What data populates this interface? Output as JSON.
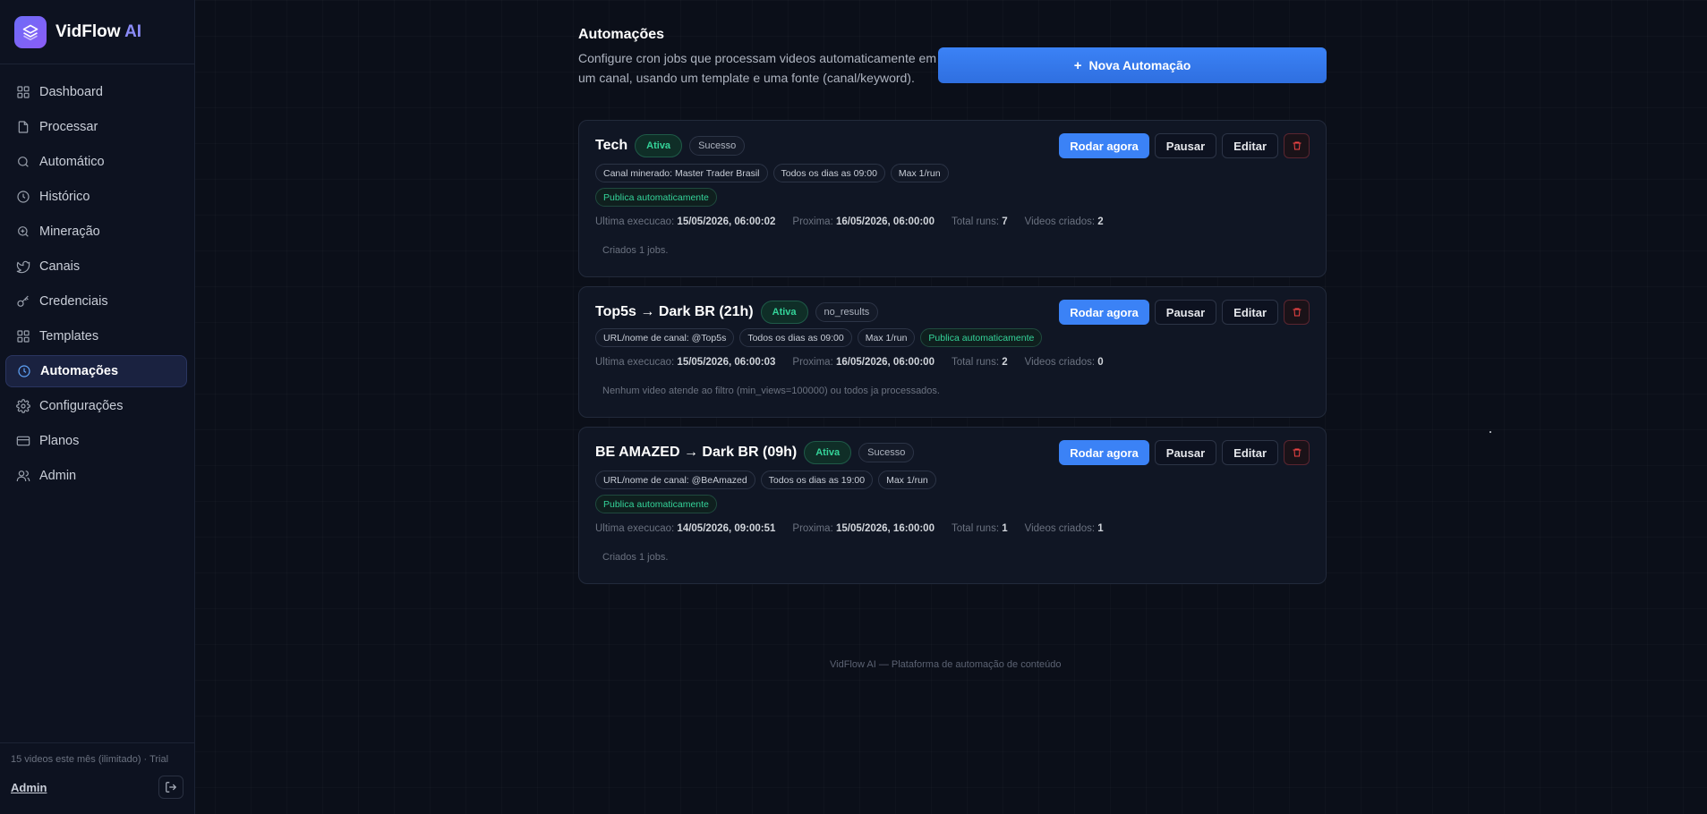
{
  "brand": {
    "name": "VidFlow",
    "accent": "AI"
  },
  "nav": [
    {
      "label": "Dashboard",
      "icon": "grid-icon"
    },
    {
      "label": "Processar",
      "icon": "file-icon"
    },
    {
      "label": "Automático",
      "icon": "search-icon"
    },
    {
      "label": "Histórico",
      "icon": "clock-icon"
    },
    {
      "label": "Mineração",
      "icon": "zoom-icon"
    },
    {
      "label": "Canais",
      "icon": "bird-icon"
    },
    {
      "label": "Credenciais",
      "icon": "key-icon"
    },
    {
      "label": "Templates",
      "icon": "grid-icon"
    },
    {
      "label": "Automações",
      "icon": "clock-icon",
      "active": true
    },
    {
      "label": "Configurações",
      "icon": "gear-icon"
    },
    {
      "label": "Planos",
      "icon": "card-icon"
    },
    {
      "label": "Admin",
      "icon": "users-icon"
    }
  ],
  "sidebar_footer": {
    "usage": "15 videos este mês (ilimitado) · Trial",
    "user": "Admin"
  },
  "header": {
    "title": "Automações",
    "description": "Configure cron jobs que processam videos automaticamente em um canal, usando um template e uma fonte (canal/keyword).",
    "new_button": "Nova Automação"
  },
  "actions": {
    "run": "Rodar agora",
    "pause": "Pausar",
    "edit": "Editar"
  },
  "stat_labels": {
    "last": "Ultima execucao:",
    "next": "Proxima:",
    "runs": "Total runs:",
    "videos": "Videos criados:"
  },
  "automations": [
    {
      "name": "Tech",
      "state": "Ativa",
      "result": "Sucesso",
      "chips": [
        "Canal minerado: Master Trader Brasil",
        "Todos os dias as 09:00",
        "Max 1/run"
      ],
      "publish": "Publica automaticamente",
      "last_run": "15/05/2026, 06:00:02",
      "next_run": "16/05/2026, 06:00:00",
      "total_runs": "7",
      "videos_created": "2",
      "note": "Criados 1 jobs."
    },
    {
      "name": "Top5s → Dark BR (21h)",
      "state": "Ativa",
      "result": "no_results",
      "chips": [
        "URL/nome de canal: @Top5s",
        "Todos os dias as 09:00",
        "Max 1/run"
      ],
      "publish": "Publica automaticamente",
      "last_run": "15/05/2026, 06:00:03",
      "next_run": "16/05/2026, 06:00:00",
      "total_runs": "2",
      "videos_created": "0",
      "note": "Nenhum video atende ao filtro (min_views=100000) ou todos ja processados."
    },
    {
      "name": "BE AMAZED → Dark BR (09h)",
      "state": "Ativa",
      "result": "Sucesso",
      "chips": [
        "URL/nome de canal: @BeAmazed",
        "Todos os dias as 19:00",
        "Max 1/run"
      ],
      "publish": "Publica automaticamente",
      "last_run": "14/05/2026, 09:00:51",
      "next_run": "15/05/2026, 16:00:00",
      "total_runs": "1",
      "videos_created": "1",
      "note": "Criados 1 jobs."
    }
  ],
  "footer": "VidFlow AI — Plataforma de automação de conteúdo",
  "colors": {
    "background": "#0b0f19",
    "primary": "#3b82f6",
    "success": "#34d399",
    "danger": "#ef4444",
    "brand": "#8b5cf6"
  }
}
